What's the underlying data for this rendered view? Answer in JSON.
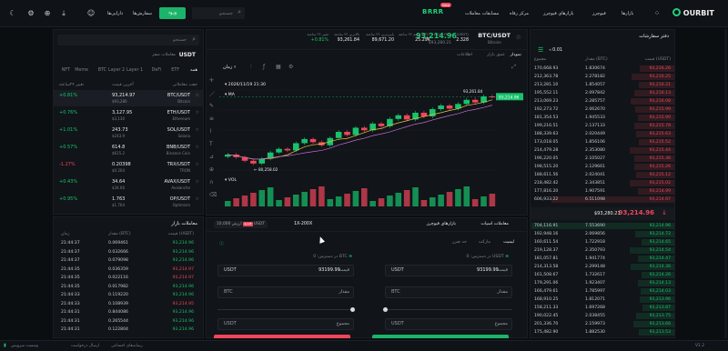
{
  "topbar": {
    "logo": "OURBIT",
    "nav": [
      "بازارها",
      "فیوچرز",
      "بازارهای فیوچرز",
      "مرکز رفاه",
      "مسابقات معاملات"
    ],
    "promo": "BRRR",
    "promo_badge": "New",
    "login": "ورود",
    "signup": "ثبت نام",
    "assets": "دارایی‌ها",
    "orders": "سفارش‌ها",
    "search_placeholder": "جستجو"
  },
  "ticker": {
    "pair": "BTC/USDT",
    "name": "Bitcoin",
    "price": "93,214.96",
    "price_usd": "$93,280.21",
    "change": "+0.81%",
    "stats": [
      {
        "label": "تغییر ۲۴ ساعته",
        "value": "+0.81%"
      },
      {
        "label": "بالاترین ۲۴ ساعته",
        "value": "93,261.84"
      },
      {
        "label": "پایین‌ترین ۲۴ ساعته",
        "value": "89,671.20"
      },
      {
        "label": "حجم ۲۴ ساعته (BTC)",
        "value": "25.29K"
      },
      {
        "label": "حجم ۲۴ ساعته (USDT)",
        "value": "2.328"
      }
    ]
  },
  "chart": {
    "tabs": [
      "نمودار",
      "عمق بازار",
      "اطلاعات"
    ],
    "timeframes": [
      "زمان",
      "15m",
      "1H",
      "4H",
      "1D",
      "1W"
    ],
    "date": "2026/11/19 21:30",
    "ma_label": "MA",
    "vol_label": "VOL",
    "high_label": "93,261.84",
    "low_label": "80,258.02",
    "last_label": "93,214.96",
    "chart_data": {
      "type": "line",
      "series": [
        {
          "values": [
            82000,
            81500,
            80800,
            80258,
            81200,
            82400,
            83100,
            82800,
            84200,
            85000,
            84400,
            83800,
            85200,
            86400,
            85800,
            87200,
            86700,
            88000,
            87500,
            88900,
            89600,
            88800,
            90100,
            89400,
            90800,
            91500,
            90900,
            91800,
            92600,
            92100,
            93261,
            93214
          ]
        }
      ]
    }
  },
  "orderbook": {
    "title": "دفتر سفارشات",
    "precision": "0.01",
    "headers": [
      "مقدار (BTC)",
      "قیمت (USDT)",
      "مجموع"
    ],
    "asks": [
      [
        "170,668.93",
        "1.830674",
        "93,216.26"
      ],
      [
        "212,363.78",
        "2.278182",
        "93,216.25"
      ],
      [
        "213,281.10",
        "1.854057",
        "93,216.21"
      ],
      [
        "195,552.11",
        "2.097842",
        "93,216.13"
      ],
      [
        "213,069.23",
        "2.285757",
        "93,216.08"
      ],
      [
        "192,273.72",
        "2.062670",
        "93,215.99"
      ],
      [
        "181,354.53",
        "1.945533",
        "93,215.90"
      ],
      [
        "199,216.51",
        "2.137133",
        "93,215.78"
      ],
      [
        "188,339.63",
        "2.020449",
        "93,215.63"
      ],
      [
        "173,018.05",
        "1.856106",
        "93,215.52"
      ],
      [
        "214,479.28",
        "2.353080",
        "93,215.44"
      ],
      [
        "196,220.05",
        "2.105027",
        "93,215.36"
      ],
      [
        "198,515.20",
        "2.129661",
        "93,215.26"
      ],
      [
        "188,611.56",
        "2.024041",
        "93,215.12"
      ],
      [
        "218,482.42",
        "2.343851",
        "93,215.02"
      ],
      [
        "177,816.20",
        "1.907591",
        "93,214.99"
      ],
      [
        "606,933.22",
        "6.511098",
        "93,214.97"
      ]
    ],
    "mid_price": "93,214.96",
    "mid_usd": "$93,280.21",
    "bids": [
      [
        "704,116.91",
        "7.553690",
        "93,214.96"
      ],
      [
        "192,948.16",
        "2.069856",
        "93,214.72"
      ],
      [
        "160,611.54",
        "1.722918",
        "93,214.65"
      ],
      [
        "219,128.37",
        "2.350793",
        "93,214.54"
      ],
      [
        "181,057.81",
        "1.941774",
        "93,214.47"
      ],
      [
        "214,313.58",
        "2.299148",
        "93,214.36"
      ],
      [
        "161,508.67",
        "1.732617",
        "93,214.26"
      ],
      [
        "179,291.06",
        "1.923407",
        "93,214.13"
      ],
      [
        "166,479.61",
        "1.785997",
        "93,214.03"
      ],
      [
        "168,910.25",
        "1.812071",
        "93,213.96"
      ],
      [
        "158,211.33",
        "1.697268",
        "93,213.87"
      ],
      [
        "190,022.45",
        "2.038455",
        "93,213.75"
      ],
      [
        "201,336.70",
        "2.159973",
        "93,213.66"
      ],
      [
        "175,482.90",
        "1.882530",
        "93,213.53"
      ]
    ]
  },
  "markets": {
    "search_placeholder": "جستجو",
    "tab_main": "USDT",
    "tab_sub": "معاملات صفر",
    "filters": [
      "همه",
      "ETF",
      "DeFi",
      "Layer 1",
      "Layer 2",
      "BTC",
      "Meme",
      "NFT"
    ],
    "headers": [
      "جفت معاملاتی",
      "آخرین قیمت",
      "تغییر ۲۴ساعته"
    ],
    "rows": [
      {
        "pair": "BTC/USDT",
        "name": "Bitcoin",
        "price": "93,214.97",
        "usd": "$93,280",
        "change": "+0.81%",
        "up": true
      },
      {
        "pair": "ETH/USDT",
        "name": "Ethereum",
        "price": "3,127.95",
        "usd": "$3,130",
        "change": "+0.76%",
        "up": true
      },
      {
        "pair": "SOL/USDT",
        "name": "Solana",
        "price": "243.73",
        "usd": "$243.9",
        "change": "+1.01%",
        "up": true
      },
      {
        "pair": "BNB/USDT",
        "name": "Binance Coin",
        "price": "614.8",
        "usd": "$615.2",
        "change": "+0.57%",
        "up": true
      },
      {
        "pair": "TRX/USDT",
        "name": "TRON",
        "price": "0.20398",
        "usd": "$0.204",
        "change": "-1.27%",
        "up": false
      },
      {
        "pair": "AVAX/USDT",
        "name": "Avalanche",
        "price": "34.64",
        "usd": "$34.66",
        "change": "+0.43%",
        "up": true
      },
      {
        "pair": "OP/USDT",
        "name": "Optimism",
        "price": "1.763",
        "usd": "$1.764",
        "change": "+0.95%",
        "up": true
      }
    ]
  },
  "trades": {
    "title": "معاملات بازار",
    "headers": [
      "زمان",
      "مقدار (BTC)",
      "قیمت (USDT)"
    ],
    "rows": [
      [
        "21:44:37",
        "0.069461",
        "93,214.96",
        true
      ],
      [
        "21:44:37",
        "0.032666",
        "93,214.96",
        true
      ],
      [
        "21:44:37",
        "0.079098",
        "93,214.96",
        true
      ],
      [
        "21:44:35",
        "0.036359",
        "93,214.97",
        false
      ],
      [
        "21:44:35",
        "0.022116",
        "93,214.97",
        false
      ],
      [
        "21:44:35",
        "0.017982",
        "93,214.96",
        true
      ],
      [
        "21:44:33",
        "0.119220",
        "93,214.96",
        true
      ],
      [
        "21:44:33",
        "0.108939",
        "93,214.95",
        false
      ],
      [
        "21:44:31",
        "0.844086",
        "93,214.96",
        true
      ],
      [
        "21:44:31",
        "0.265544",
        "93,214.96",
        true
      ],
      [
        "21:44:31",
        "0.122804",
        "93,214.96",
        true
      ]
    ]
  },
  "order_form": {
    "tabs": [
      "معاملات اسپات",
      "بازارهای فیوچرز",
      "1X-200X"
    ],
    "promo": "ارزش 10,000 USDT",
    "promo_badge": "جدید",
    "order_types": [
      "لیمیت",
      "مارکت",
      "حد ضرر"
    ],
    "buy_avail": "در دسترس: 0 USDT",
    "sell_avail": "در دسترس: 0 BTC",
    "price_label": "قیمت",
    "price_value": "93199.99",
    "price_unit": "USDT",
    "amount_label": "مقدار",
    "amount_unit": "BTC",
    "total_label": "مجموع",
    "total_unit": "USDT"
  },
  "statusbar": {
    "left": "وضعیت سرویس",
    "items": [
      "ارسال درخواست",
      "رسانه‌های اجتماعی",
      "تنظیمات",
      "نسخه"
    ],
    "right": "V1.2"
  }
}
